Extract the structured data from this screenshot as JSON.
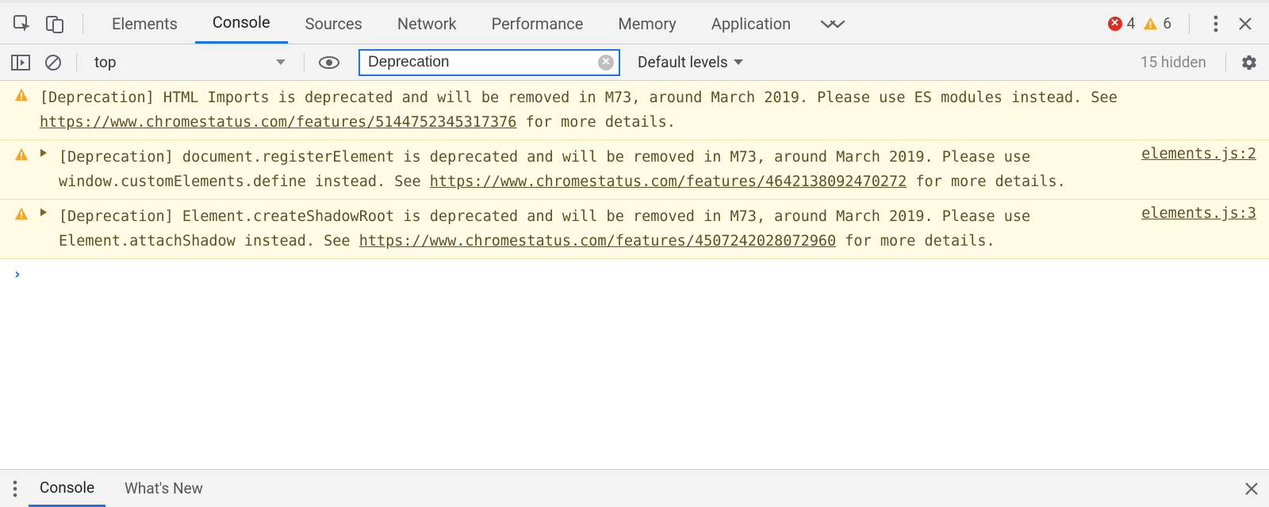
{
  "tabs": {
    "elements": "Elements",
    "console": "Console",
    "sources": "Sources",
    "network": "Network",
    "performance": "Performance",
    "memory": "Memory",
    "application": "Application"
  },
  "status": {
    "errors": "4",
    "warnings": "6"
  },
  "toolbar": {
    "context": "top",
    "filter_value": "Deprecation",
    "levels_label": "Default levels",
    "hidden_label": "15 hidden"
  },
  "messages": [
    {
      "expandable": false,
      "text_pre": "[Deprecation] HTML Imports is deprecated and will be removed in M73, around March 2019. Please use ES modules instead. See ",
      "link": "https://www.chromestatus.com/features/5144752345317376",
      "text_post": " for more details.",
      "source": ""
    },
    {
      "expandable": true,
      "text_pre": "[Deprecation] document.registerElement is deprecated and will be removed in M73, around March 2019. Please use window.customElements.define instead. See ",
      "link": "https://www.chromestatus.com/features/4642138092470272",
      "text_post": " for more details.",
      "source": "elements.js:2"
    },
    {
      "expandable": true,
      "text_pre": "[Deprecation] Element.createShadowRoot is deprecated and will be removed in M73, around March 2019. Please use Element.attachShadow instead. See ",
      "link": "https://www.chromestatus.com/features/4507242028072960",
      "text_post": " for more details.",
      "source": "elements.js:3"
    }
  ],
  "drawer": {
    "console": "Console",
    "whatsnew": "What's New"
  }
}
